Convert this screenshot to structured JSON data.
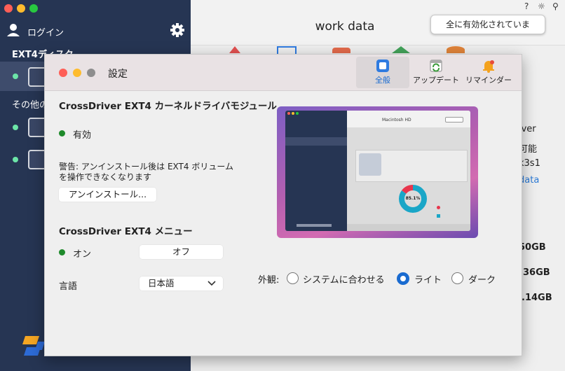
{
  "background": {
    "sidebar": {
      "login_label": "ログイン",
      "section_ext4": "EXT4ディスク",
      "section_other": "その他の"
    },
    "main": {
      "title": "work data",
      "toast": "全に有効化されていま",
      "top_icons": [
        "help-icon",
        "sun-icon",
        "pin-icon"
      ],
      "right_texts": [
        "iver",
        "可能",
        "k3s1",
        "data",
        "50GB",
        "36GB",
        ".14GB"
      ]
    }
  },
  "dialog": {
    "title": "設定",
    "tabs": [
      {
        "label": "全般",
        "icon": "general-icon"
      },
      {
        "label": "アップデート",
        "icon": "update-icon"
      },
      {
        "label": "リマインダー",
        "icon": "bell-icon"
      }
    ],
    "module_heading": "CrossDriver EXT4 カーネルドライバモジュール",
    "module_status": "有効",
    "warning_line1": "警告: アンインストール後は EXT4 ボリューム",
    "warning_line2": "を操作できなくなります",
    "uninstall_label": "アンインストール...",
    "menu_heading": "CrossDriver EXT4 メニュー",
    "menu_on": "オン",
    "menu_off": "オフ",
    "language_label": "言語",
    "language_value": "日本語",
    "appearance_label": "外観:",
    "appearance_options": [
      "システムに合わせる",
      "ライト",
      "ダーク"
    ],
    "appearance_selected": "ライト",
    "preview": {
      "window_title": "Macintosh HD",
      "donut_value": "85.1%",
      "donut_percent": 85.1
    }
  },
  "colors": {
    "sidebar_bg": "#263553",
    "accent_blue": "#1a6bd0",
    "status_green": "#1e8a2b"
  }
}
